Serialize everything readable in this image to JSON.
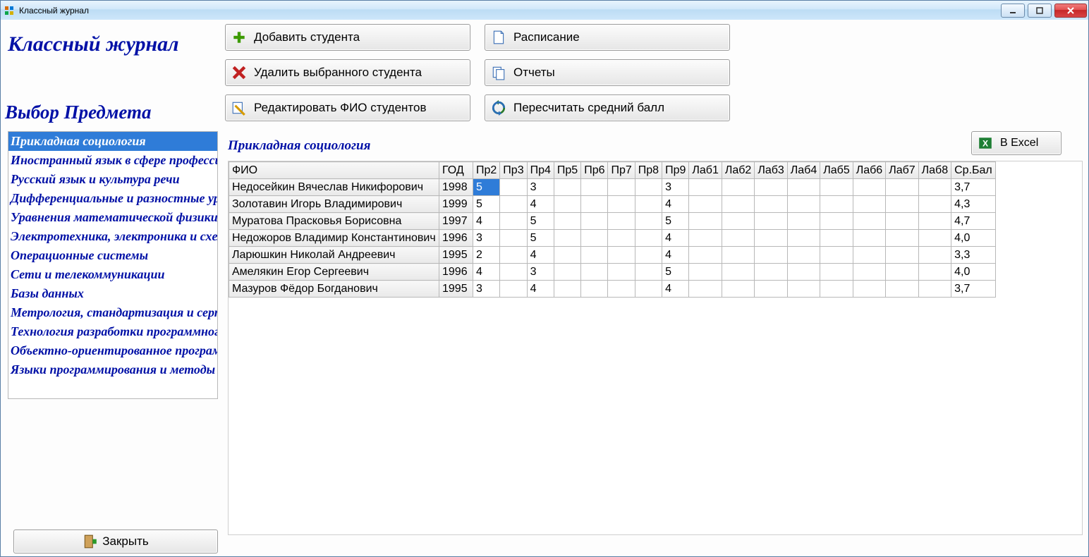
{
  "window": {
    "title": "Классный журнал"
  },
  "headings": {
    "main": "Классный журнал",
    "sub": "Выбор Предмета"
  },
  "buttons": {
    "add": "Добавить студента",
    "del": "Удалить выбранного студента",
    "edit": "Редактировать ФИО студентов",
    "schedule": "Расписание",
    "reports": "Отчеты",
    "recalc": "Пересчитать средний балл",
    "excel": "В Excel",
    "close": "Закрыть"
  },
  "subjects": {
    "selected_index": 0,
    "items": [
      "Прикладная социология",
      "Иностранный язык в сфере профессиональной коммуникации",
      "Русский язык и культура речи",
      "Дифференциальные и разностные уравнения",
      "Уравнения математической физики",
      "Электротехника, электроника и схемотехника",
      "Операционные системы",
      "Сети и телекоммуникации",
      "Базы данных",
      "Метрология, стандартизация и сертификация",
      "Технология разработки программного обеспечения",
      "Объектно-ориентированное программирование",
      "Языки программирования и методы трансляции"
    ]
  },
  "current_subject": "Прикладная социология",
  "table": {
    "columns": [
      "ФИО",
      "ГОД",
      "Пр2",
      "Пр3",
      "Пр4",
      "Пр5",
      "Пр6",
      "Пр7",
      "Пр8",
      "Пр9",
      "Лаб1",
      "Лаб2",
      "Лаб3",
      "Лаб4",
      "Лаб5",
      "Лаб6",
      "Лаб7",
      "Лаб8",
      "Ср.Бал"
    ],
    "selected_cell": {
      "row": 0,
      "col": 2
    },
    "rows": [
      {
        "fio": "Недосейкин Вячеслав  Никифорович",
        "year": "1998",
        "pr2": "5",
        "pr3": "",
        "pr4": "3",
        "pr5": "",
        "pr6": "",
        "pr7": "",
        "pr8": "",
        "pr9": "3",
        "l1": "",
        "l2": "",
        "l3": "",
        "l4": "",
        "l5": "",
        "l6": "",
        "l7": "",
        "l8": "",
        "avg": "3,7"
      },
      {
        "fio": "Золотавин Игорь  Владимирович",
        "year": "1999",
        "pr2": "5",
        "pr3": "",
        "pr4": "4",
        "pr5": "",
        "pr6": "",
        "pr7": "",
        "pr8": "",
        "pr9": "4",
        "l1": "",
        "l2": "",
        "l3": "",
        "l4": "",
        "l5": "",
        "l6": "",
        "l7": "",
        "l8": "",
        "avg": "4,3"
      },
      {
        "fio": "Муратова Прасковья  Борисовна",
        "year": "1997",
        "pr2": "4",
        "pr3": "",
        "pr4": "5",
        "pr5": "",
        "pr6": "",
        "pr7": "",
        "pr8": "",
        "pr9": "5",
        "l1": "",
        "l2": "",
        "l3": "",
        "l4": "",
        "l5": "",
        "l6": "",
        "l7": "",
        "l8": "",
        "avg": "4,7"
      },
      {
        "fio": "Недожоров Владимир  Константинович",
        "year": "1996",
        "pr2": "3",
        "pr3": "",
        "pr4": "5",
        "pr5": "",
        "pr6": "",
        "pr7": "",
        "pr8": "",
        "pr9": "4",
        "l1": "",
        "l2": "",
        "l3": "",
        "l4": "",
        "l5": "",
        "l6": "",
        "l7": "",
        "l8": "",
        "avg": "4,0"
      },
      {
        "fio": "Ларюшкин Николай  Андреевич",
        "year": "1995",
        "pr2": "2",
        "pr3": "",
        "pr4": "4",
        "pr5": "",
        "pr6": "",
        "pr7": "",
        "pr8": "",
        "pr9": "4",
        "l1": "",
        "l2": "",
        "l3": "",
        "l4": "",
        "l5": "",
        "l6": "",
        "l7": "",
        "l8": "",
        "avg": "3,3"
      },
      {
        "fio": "Амелякин Егор  Сергеевич",
        "year": "1996",
        "pr2": "4",
        "pr3": "",
        "pr4": "3",
        "pr5": "",
        "pr6": "",
        "pr7": "",
        "pr8": "",
        "pr9": "5",
        "l1": "",
        "l2": "",
        "l3": "",
        "l4": "",
        "l5": "",
        "l6": "",
        "l7": "",
        "l8": "",
        "avg": "4,0"
      },
      {
        "fio": "Мазуров Фёдор  Богданович",
        "year": "1995",
        "pr2": "3",
        "pr3": "",
        "pr4": "4",
        "pr5": "",
        "pr6": "",
        "pr7": "",
        "pr8": "",
        "pr9": "4",
        "l1": "",
        "l2": "",
        "l3": "",
        "l4": "",
        "l5": "",
        "l6": "",
        "l7": "",
        "l8": "",
        "avg": "3,7"
      }
    ]
  }
}
